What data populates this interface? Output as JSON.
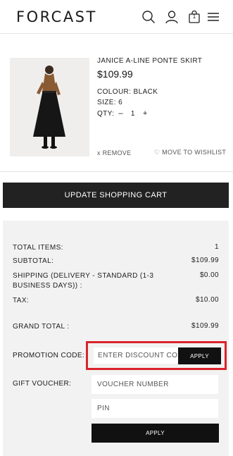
{
  "header": {
    "logo": "FORCAST",
    "icons": [
      "search-icon",
      "user-icon",
      "cart-icon",
      "menu-icon"
    ],
    "cart_count": "1"
  },
  "product": {
    "name": "JANICE A-LINE PONTE SKIRT",
    "price": "$109.99",
    "colour": "COLOUR: BLACK",
    "size": "SIZE: 6",
    "qty_label": "QTY:",
    "qty_minus": "–",
    "qty_value": "1",
    "qty_plus": "+",
    "remove": "x REMOVE",
    "wishlist": "♡ MOVE TO WISHLIST"
  },
  "update_cart_label": "UPDATE SHOPPING CART",
  "summary": {
    "total_items_label": "TOTAL ITEMS:",
    "total_items_value": "1",
    "subtotal_label": "SUBTOTAL:",
    "subtotal_value": "$109.99",
    "shipping_label": "SHIPPING (DELIVERY - STANDARD (1-3 BUSINESS DAYS)) :",
    "shipping_value": "$0.00",
    "tax_label": "TAX:",
    "tax_value": "$10.00",
    "grand_total_label": "GRAND TOTAL :",
    "grand_total_value": "$109.99"
  },
  "promo": {
    "label": "PROMOTION CODE:",
    "placeholder": "ENTER DISCOUNT CODE",
    "apply": "APPLY"
  },
  "gift": {
    "label": "GIFT VOUCHER:",
    "voucher_placeholder": "VOUCHER NUMBER",
    "pin_placeholder": "PIN",
    "apply": "APPLY"
  },
  "colors": {
    "accent_dark": "#222222",
    "highlight_red": "#d9232b",
    "summary_bg": "#f2f2f2"
  }
}
